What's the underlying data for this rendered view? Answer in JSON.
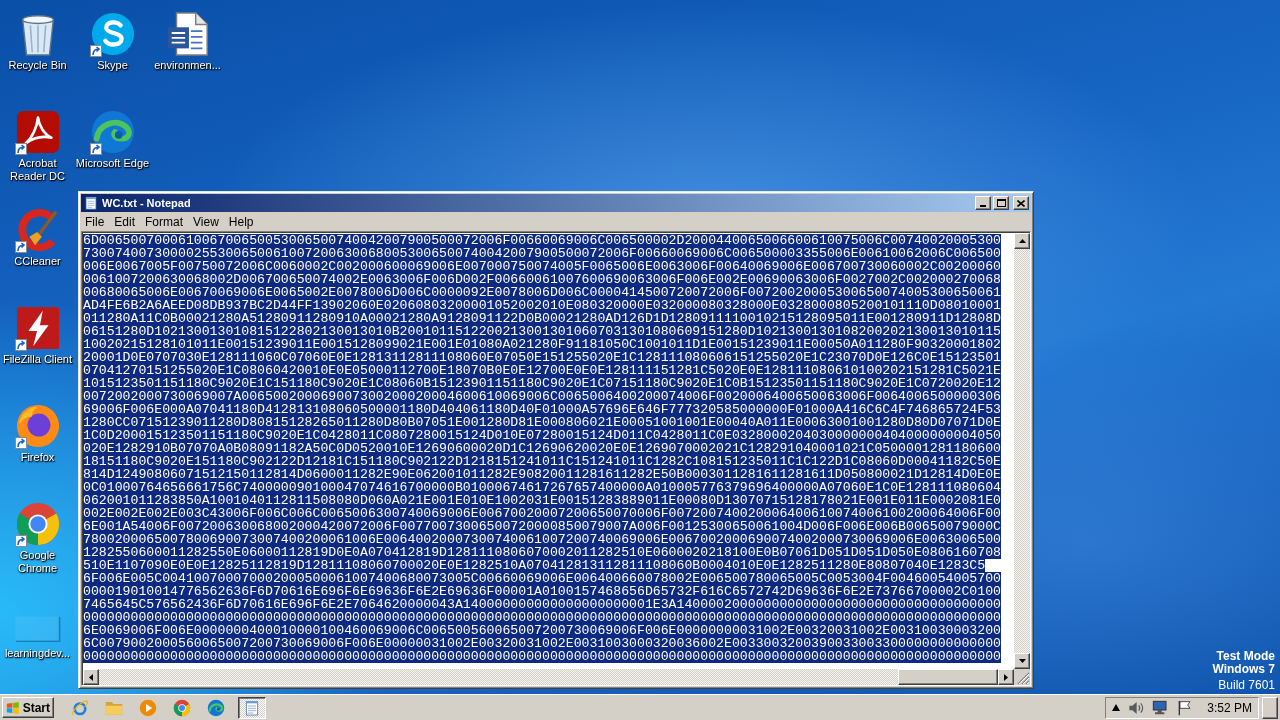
{
  "desktop": {
    "icon_rows": [
      [
        {
          "kind": "recycle-bin",
          "label": "Recycle Bin",
          "shortcut": false
        },
        {
          "kind": "skype",
          "label": "Skype",
          "shortcut": true
        },
        {
          "kind": "word-document",
          "label": "environmen...",
          "shortcut": false
        }
      ],
      [
        {
          "kind": "acrobat",
          "label": "Acrobat Reader DC",
          "shortcut": true
        },
        {
          "kind": "edge",
          "label": "Microsoft Edge",
          "shortcut": true
        }
      ],
      [
        {
          "kind": "ccleaner",
          "label": "CCleaner",
          "shortcut": true
        }
      ],
      [
        {
          "kind": "filezilla",
          "label": "FileZilla Client",
          "shortcut": true
        }
      ],
      [
        {
          "kind": "firefox",
          "label": "Firefox",
          "shortcut": true
        }
      ],
      [
        {
          "kind": "chrome",
          "label": "Google Chrome",
          "shortcut": true
        }
      ],
      [
        {
          "kind": "blank-window",
          "label": "learningdev...",
          "shortcut": false
        }
      ]
    ]
  },
  "system_info": [
    "Test Mode",
    "Windows 7",
    "Build 7601"
  ],
  "notepad": {
    "title": "WC.txt - Notepad",
    "menu": [
      "File",
      "Edit",
      "Format",
      "View",
      "Help"
    ],
    "text": {
      "selected": true,
      "lines": [
        "6D006500700061006700650053006500740042007900500072006F00660069006C006500002D2000440065006600610075006C00740020005300",
        "730074007300002553006500610072006300680053006500740042007900500072006F00660069006C006500003355006E00610062006C006500",
        "006E0067005F00750072006C0060002C002000600069006E007000750074005F0065006E0063006F00640069006E006700730060002C00200060",
        "0061007200630068002D006700650074002E0063006F006D002F00660061007600690063006F006E002E00690063006F0027002C002000270068",
        "00680065006E00670069006E0065002E0078006D006C0000092E0078006D006C0000414500720072006F00720020005300650074005300650061",
        "AD4FE6B2A6AEED08DB937BC2D44FF13902060E02060803200001052002010E080320000E032000080328000E0328000805200101110D08010001",
        "011280A11C0B00021280A51280911280910A00021280A9128091122D0B00021280AD126D1D1280911110010215128095011E001280911D12808D",
        "06151280D102130013010815122802130013010B20010115122002130013010607031301080609151280D1021300130108200202130013010115",
        "10020215128101011E00151239011E0015128099021E001E01080A021280F91181050C1001011D1E00151239011E00050A011280F90320001802",
        "20001D0E0707030E128111060C07060E0E12813112811108060E07050E151255020E1C128111080606151255020E1C23070D0E126C0E15123501",
        "07041270151255020E1C08060420010E0E05000112700E18070B0E0E12700E0E0E128111151281C5020E0E128111080610100202151281C5021E",
        "1015123501151180C9020E1C151180C9020E1C08060B15123901151180C9020E1C07151180C9020E1C0B15123501151180C9020E1C0720020E12",
        "0072002000730069007A006500200069007300200020004600610069006C0065006400200074006F0020006400650063006F0064006500000306",
        "69006F006E000A07041180D412813108060500001180D404061180D40F01000A57696E646F777320585000000F01000A416C6C4F746865724F53",
        "1280CC07151239011280D80815128265011280D80B07051E001280D81E000806021E00051001001E00040A011E00063001001280D80D07071D0E",
        "1C0D200015123501151180C9020E1C0428011C0807280015124D010E07280015124D011C0428011C0E0328000204030000000404000000004050",
        "020E1282910B07070A0B08091182A50C0D0520010E12690600020D1C12690620020E0E1269070002021C128291040001021C0500001281180600",
        "18151180C9020E151180C902122D12181C151180C902122D1218151241011C151241011C1282C108151235011C1C122D1C08060D00041182C50E",
        "814D12490806071512150112814D0600011282E90E062001011282E90820011281611282E50B0003011281611281611D050800021D12814D0E0E",
        "0C01000764656661756C740000090100047074616700000B01000674617267657400000A010005776379696400000A07060E1C0E128111080604",
        "062001011283850A1001040112811508080D060A021E001E010E1002031E00151283889011E00080D13070715128178021E001E011E0002081E0",
        "002E002E002E003C43006F006C006C0065006300740069006E00670020007200650070006F007200740020006400610074006100200064006F00",
        "6E001A54006F007200630068002000420072006F00770073006500720000850079007A006F00125300650061004D006F006E006B00650079000C",
        "7800200065007800690073007400200061006E00640020007300740061007200740069006E0067002000690074002000730069006E0063006500",
        "1282550600011282550E06000112819D0E0A070412819D1281110806070002011282510E0600020218100E0B07061D051D051D050E0806160708",
        "510E1107090E0E0E12825112819D12811108060700020E0E1282510A070412813112811108060B0004010E0E1282511280E80807040E1283C5",
        "6F006E005C004100700070002000500061007400680073005C00660069006E006400660078002E006500780065005C0053004F00460054005700",
        "000019010014776562636F6D70616E696F6E69636F6E2E69636F00001A0100157468656D65732F616C6572742D69636F6E2E73766700002C0100",
        "7465645C576562436F6D70616E696F6E2E7064620000043A140000000000000000000001E3A14000020000000000000000000000000000000000",
        "00000000000000000000000000000000000000000000000000000000000000000000000000000000000000000000000000000000000000000000",
        "6E0069006F006E0000000400010000100460069006C006500560065007200730069006F006E00000000031002E00320031002E00310030003200",
        "6C0079002000560065007200730069006F006E00000031002E00320031002E0031003000320036002E0033003200390033003300000000000000",
        "00000000000000000000000000000000000000000000000000000000000000000000000000000000000000000000000000000000000000000000"
      ]
    }
  },
  "taskbar": {
    "start": "Start",
    "pinned": [
      {
        "kind": "internet-explorer"
      },
      {
        "kind": "explorer"
      },
      {
        "kind": "media-player"
      },
      {
        "kind": "chrome"
      },
      {
        "kind": "edge"
      }
    ],
    "tasks": [
      {
        "kind": "notepad",
        "selected": true
      }
    ],
    "tray": [
      {
        "kind": "show-hidden"
      },
      {
        "kind": "speaker"
      },
      {
        "kind": "network"
      },
      {
        "kind": "action-center"
      }
    ],
    "clock": "3:52 PM"
  }
}
